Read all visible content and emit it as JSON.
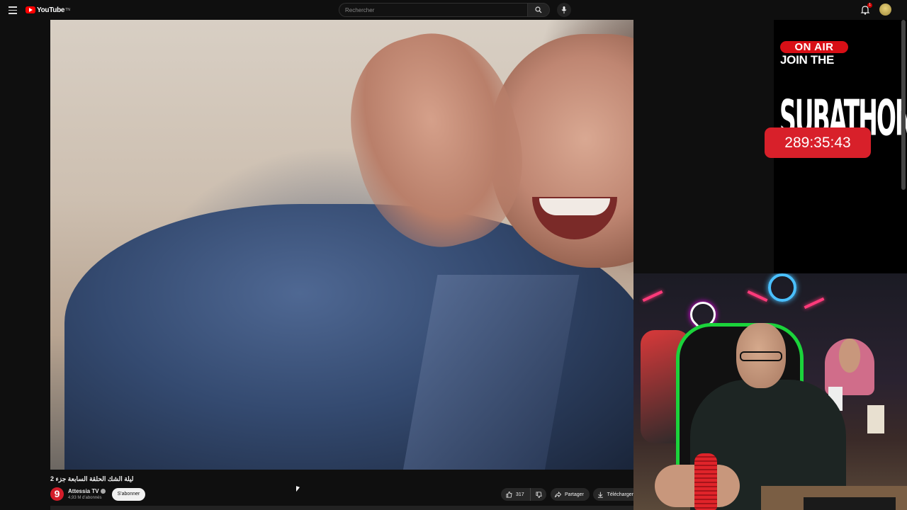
{
  "header": {
    "logo_text": "YouTube",
    "logo_tm": "TN",
    "search_placeholder": "Rechercher",
    "notification_count": "1"
  },
  "overlay": {
    "on_air": "ON AIR",
    "join_the": "JOIN THE",
    "subathon": "SUBATHON",
    "timer": "289:35:43"
  },
  "video": {
    "title": "ليلة الشك الحلقة السابعة جزء 2",
    "channel_logo": "9",
    "channel_name": "Attessia TV",
    "subscribers": "4,93 M d'abonnés",
    "subscribe_label": "S'abonner",
    "likes": "317",
    "share_label": "Partager",
    "download_label": "Télécharger"
  },
  "colors": {
    "youtube_red": "#ff0000",
    "onair_red": "#d80f16",
    "timer_red": "#d8202a",
    "chair_green": "#1bd33b"
  }
}
